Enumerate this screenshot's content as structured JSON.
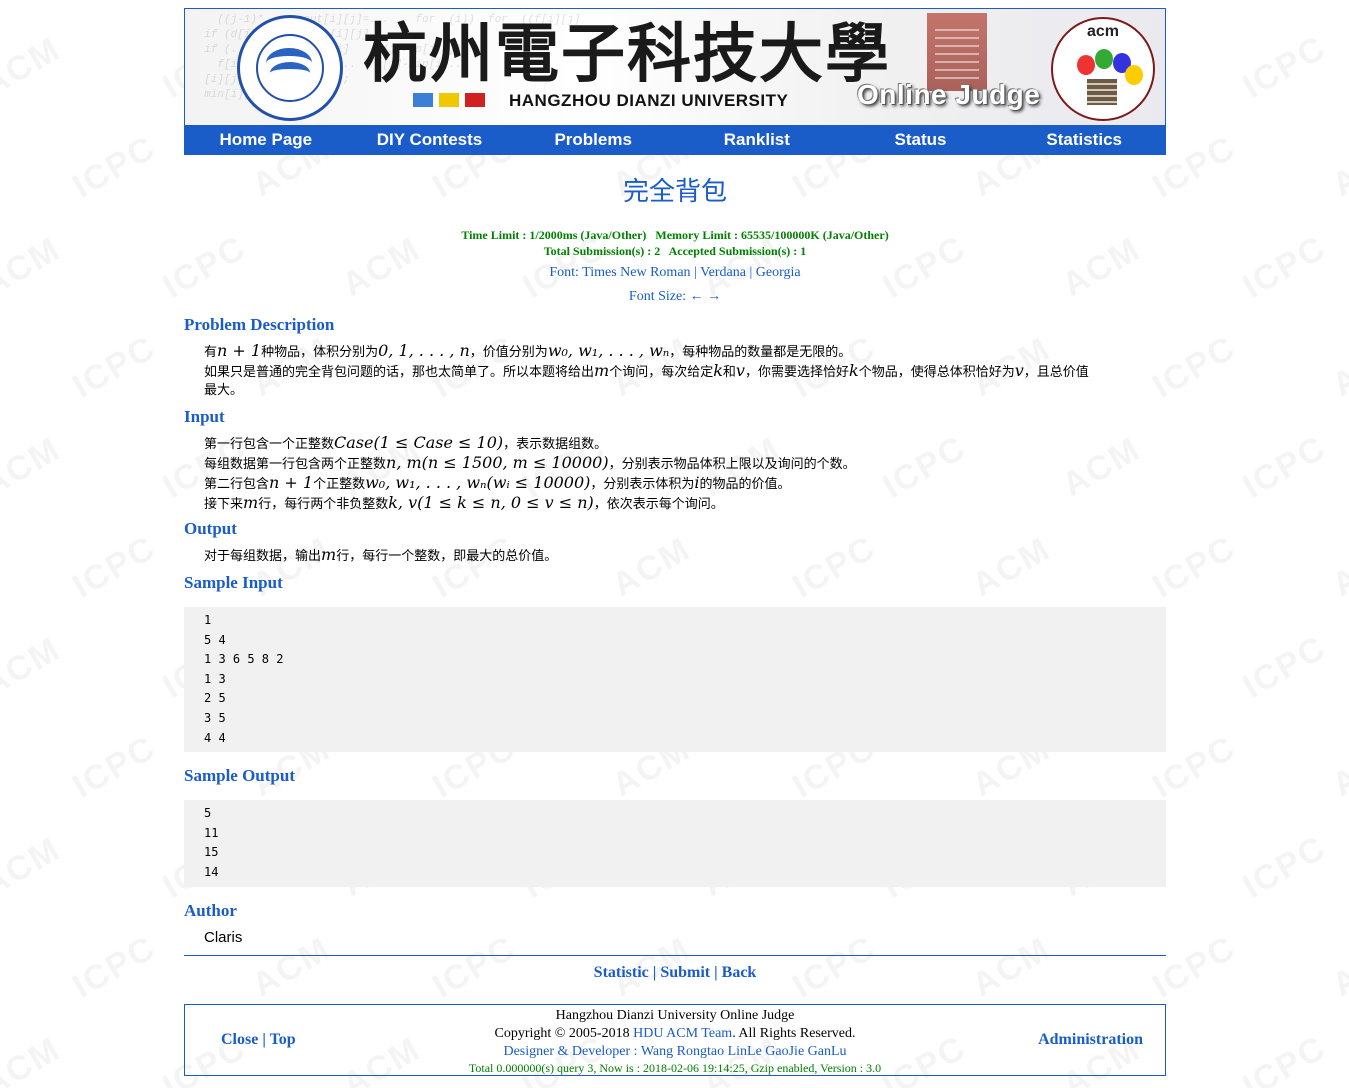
{
  "header": {
    "university_cn": "杭州電子科技大學",
    "university_en": "HANGZHOU DIANZI UNIVERSITY",
    "oj_title": "Online Judge",
    "acm_text": "acm",
    "code_snippet": "    ((j-1)*...  cout[i][j]=...    for  (i))  for  ((f[i][j]\n  if (d[i]...  ...min[i][j]\n  if (...)     ...min[i]     (j]>dp[j-1])\n    f[i][j]...  dp[j]=...    [i]-min[i]...\n  [i][j]-...   i-source;\n  min[i][j]..."
  },
  "nav": {
    "items": [
      "Home Page",
      "DIY Contests",
      "Problems",
      "Ranklist",
      "Status",
      "Statistics"
    ]
  },
  "problem": {
    "title": "完全背包",
    "limits_line1": "Time Limit : 1/2000ms (Java/Other)   Memory Limit : 65535/100000K (Java/Other)",
    "limits_line2": "Total Submission(s) : 2   Accepted Submission(s) : 1",
    "font_label": "Font: ",
    "font_options": [
      "Times New Roman",
      "Verdana",
      "Georgia"
    ],
    "font_size_label": "Font Size: ",
    "font_size_dec": "←",
    "font_size_inc": "→"
  },
  "sections": {
    "description_title": "Problem Description",
    "input_title": "Input",
    "output_title": "Output",
    "sample_input_title": "Sample Input",
    "sample_output_title": "Sample Output",
    "author_title": "Author"
  },
  "description": {
    "l1_a": "有",
    "l1_m1": "n + 1",
    "l1_b": "种物品，体积分别为",
    "l1_m2": "0, 1, . . . , n",
    "l1_c": "，价值分别为",
    "l1_m3": "w₀, w₁, . . . , wₙ",
    "l1_d": "，每种物品的数量都是无限的。",
    "l2_a": "如果只是普通的完全背包问题的话，那也太简单了。所以本题将给出",
    "l2_m1": "m",
    "l2_b": "个询问，每次给定",
    "l2_m2": "k",
    "l2_c": "和",
    "l2_m3": "v",
    "l2_d": "，你需要选择恰好",
    "l2_m4": "k",
    "l2_e": "个物品，使得总体积恰好为",
    "l2_m5": "v",
    "l2_f": "，且总价值",
    "l3": "最大。"
  },
  "input_text": {
    "l1_a": "第一行包含一个正整数",
    "l1_m": "Case(1 ≤ Case ≤ 10)",
    "l1_b": "，表示数据组数。",
    "l2_a": "每组数据第一行包含两个正整数",
    "l2_m": "n, m(n ≤ 1500, m ≤ 10000)",
    "l2_b": "，分别表示物品体积上限以及询问的个数。",
    "l3_a": "第二行包含",
    "l3_m1": "n + 1",
    "l3_b": "个正整数",
    "l3_m2": "w₀, w₁, . . . , wₙ(wᵢ ≤ 10000)",
    "l3_c": "，分别表示体积为",
    "l3_m3": "i",
    "l3_d": "的物品的价值。",
    "l4_a": "接下来",
    "l4_m1": "m",
    "l4_b": "行，每行两个非负整数",
    "l4_m2": "k, v(1 ≤ k ≤ n, 0 ≤ v ≤ n)",
    "l4_c": "，依次表示每个询问。"
  },
  "output_text": {
    "a": "对于每组数据，输出",
    "m": "m",
    "b": "行，每行一个整数，即最大的总价值。"
  },
  "sample_input": [
    "1",
    "5 4",
    "1 3 6 5 8 2",
    "1 3",
    "2 5",
    "3 5",
    "4 4"
  ],
  "sample_output": [
    "5",
    "11",
    "15",
    "14"
  ],
  "author": "Claris",
  "actions": {
    "statistic": "Statistic",
    "submit": "Submit",
    "back": "Back",
    "sep": " | "
  },
  "footer": {
    "close": "Close",
    "top": "Top",
    "sep": " | ",
    "admin": "Administration",
    "line1": "Hangzhou Dianzi University Online Judge",
    "line2_a": "Copyright © 2005-2018 ",
    "line2_link": "HDU ACM Team",
    "line2_b": ". All Rights Reserved.",
    "line3": "Designer & Developer : Wang Rongtao LinLe GaoJie GanLu",
    "line4": "Total 0.000000(s) query 3, Now is : 2018-02-06 19:14:25, Gzip enabled, Version : 3.0"
  },
  "watermark": {
    "a": "ACM",
    "b": "ICPC"
  },
  "colors": {
    "accent": "#1a5cc8",
    "limits": "#008000",
    "sample_bg": "#f1f1f1"
  }
}
